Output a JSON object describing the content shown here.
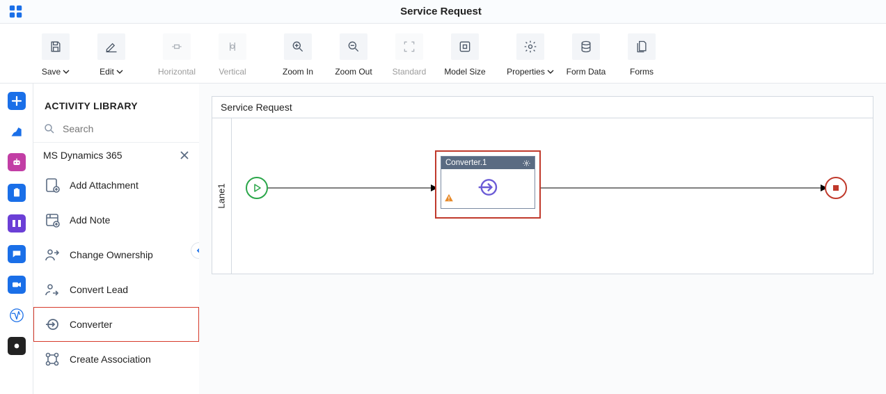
{
  "header": {
    "title": "Service Request"
  },
  "toolbar": {
    "save": "Save",
    "edit": "Edit",
    "horizontal": "Horizontal",
    "vertical": "Vertical",
    "zoom_in": "Zoom In",
    "zoom_out": "Zoom Out",
    "standard": "Standard",
    "model_size": "Model Size",
    "properties": "Properties",
    "form_data": "Form Data",
    "forms": "Forms"
  },
  "sidebar": {
    "title": "ACTIVITY LIBRARY",
    "search_placeholder": "Search",
    "category": "MS Dynamics 365",
    "items": [
      {
        "label": "Add Attachment"
      },
      {
        "label": "Add Note"
      },
      {
        "label": "Change Ownership"
      },
      {
        "label": "Convert Lead"
      },
      {
        "label": "Converter"
      },
      {
        "label": "Create Association"
      }
    ]
  },
  "canvas": {
    "title": "Service Request",
    "lane": "Lane1",
    "activity": {
      "name": "Converter.1"
    }
  }
}
